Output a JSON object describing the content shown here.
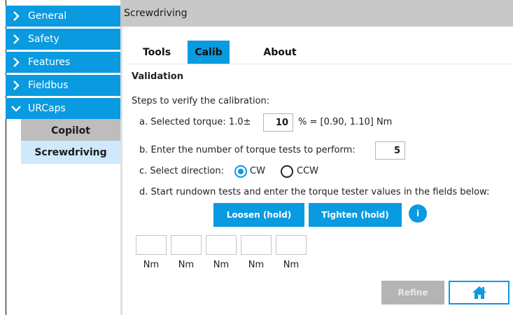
{
  "sidebar": {
    "items": [
      {
        "label": "General",
        "icon": "chevron-right-icon"
      },
      {
        "label": "Safety",
        "icon": "chevron-right-icon"
      },
      {
        "label": "Features",
        "icon": "chevron-right-icon"
      },
      {
        "label": "Fieldbus",
        "icon": "chevron-right-icon"
      },
      {
        "label": "URCaps",
        "icon": "chevron-down-icon"
      }
    ],
    "subitems": [
      {
        "label": "Copilot",
        "selected": false
      },
      {
        "label": "Screwdriving",
        "selected": true
      }
    ]
  },
  "header": {
    "title": "Screwdriving"
  },
  "tabs": [
    {
      "label": "Tools",
      "active": false
    },
    {
      "label": "Calib",
      "active": true
    },
    {
      "label": "About",
      "active": false
    }
  ],
  "validation": {
    "heading": "Validation",
    "intro": "Steps to verify the calibration:",
    "step_a_prefix": "a. Selected torque: 1.0±",
    "torque_pct": "10",
    "step_a_suffix": "% = [0.90, 1.10] Nm",
    "step_b": "b. Enter the number of torque tests to perform:",
    "tests_count": "5",
    "step_c": "c. Select direction:",
    "dir_cw": "CW",
    "dir_ccw": "CCW",
    "step_d": "d. Start rundown tests and enter the torque tester values in the fields below:",
    "loosen_label": "Loosen (hold)",
    "tighten_label": "Tighten (hold)",
    "info_label": "i",
    "units": [
      "Nm",
      "Nm",
      "Nm",
      "Nm",
      "Nm"
    ]
  },
  "footer": {
    "refine_label": "Refine"
  },
  "colors": {
    "accent": "#0a9ae0",
    "header_bg": "#c8c8c8",
    "subitem_bg": "#bdbdbd",
    "subitem_selected_bg": "#cde9fb",
    "disabled": "#b4b4b4"
  }
}
